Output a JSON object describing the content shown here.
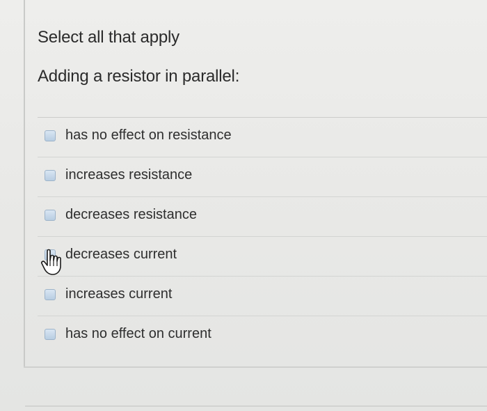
{
  "instruction": "Select all that apply",
  "question": "Adding a resistor in parallel:",
  "options": [
    {
      "label": "has no effect on resistance",
      "checked": false
    },
    {
      "label": "increases resistance",
      "checked": false
    },
    {
      "label": "decreases resistance",
      "checked": false
    },
    {
      "label": "decreases current",
      "checked": false
    },
    {
      "label": "increases current",
      "checked": false
    },
    {
      "label": "has no effect on current",
      "checked": false
    }
  ],
  "cursor_icon": "hand-pointer-icon",
  "colors": {
    "checkbox_fill": "#c6d8ea",
    "checkbox_border": "#9db3c9",
    "text": "#2e2e2e",
    "background": "#eaeae8"
  }
}
